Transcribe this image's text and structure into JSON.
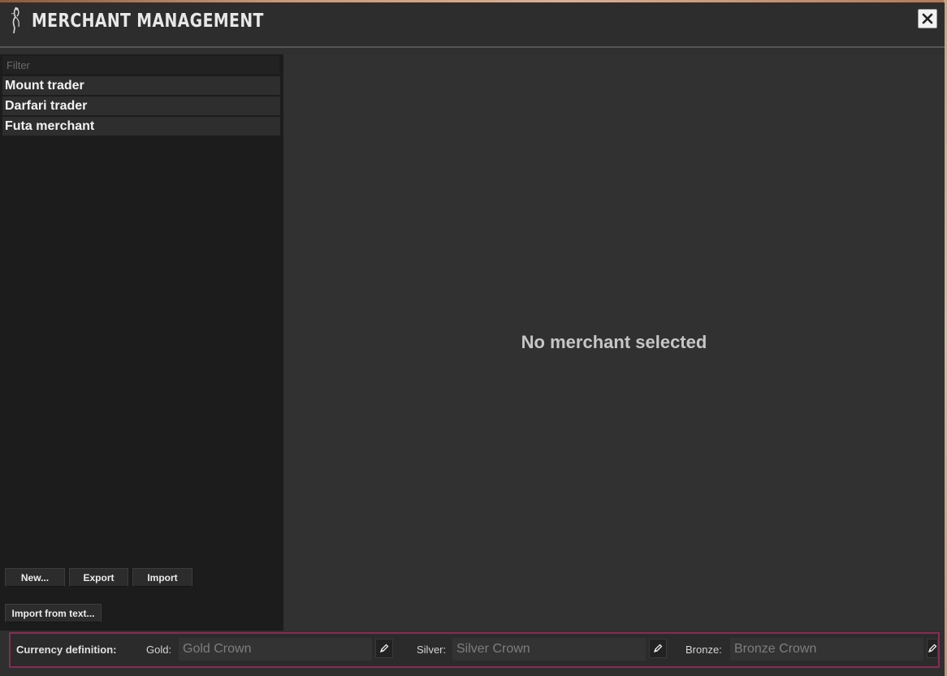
{
  "window": {
    "title": "MERCHANT MANAGEMENT",
    "logo_icon": "feather-figure-icon",
    "close_icon": "close-icon"
  },
  "sidebar": {
    "filter_placeholder": "Filter",
    "merchants": [
      "Mount trader",
      "Darfari trader",
      "Futa merchant"
    ],
    "buttons": {
      "new_label": "New...",
      "export_label": "Export",
      "import_label": "Import",
      "import_text_label": "Import from text..."
    }
  },
  "main": {
    "empty_message": "No merchant selected"
  },
  "currency": {
    "title": "Currency definition:",
    "gold_label": "Gold:",
    "gold_value": "Gold Crown",
    "silver_label": "Silver:",
    "silver_value": "Silver Crown",
    "bronze_label": "Bronze:",
    "bronze_value": "Bronze Crown",
    "edit_icon": "pencil-icon"
  },
  "colors": {
    "window_bg": "#2f2f2f",
    "sidebar_bg": "#1c1c1c",
    "highlight_border": "#8a2a55"
  }
}
